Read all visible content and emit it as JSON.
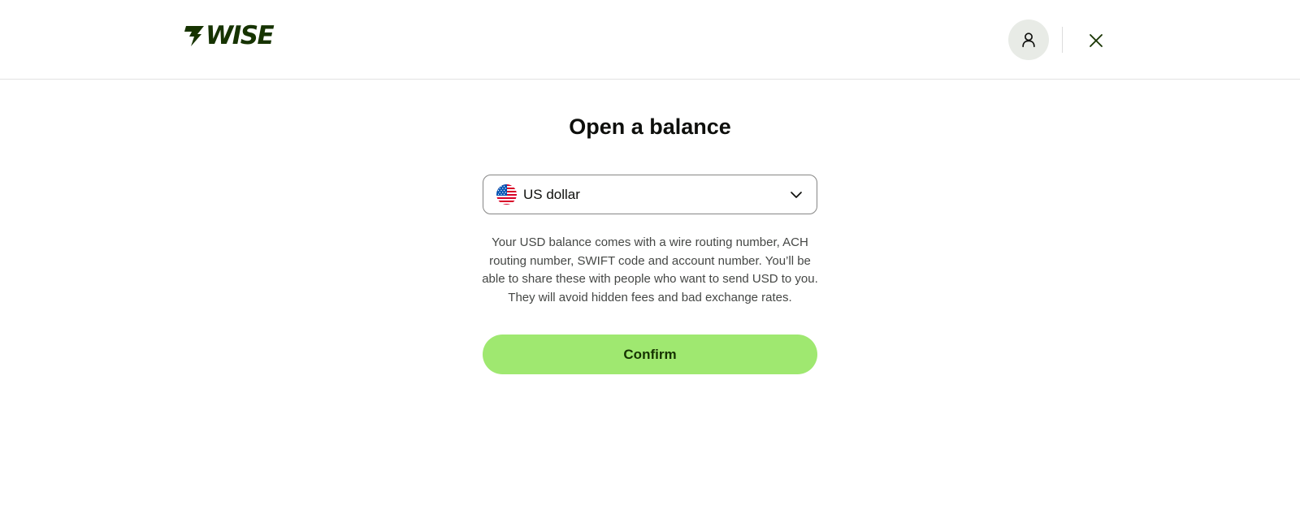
{
  "header": {
    "logo_text": "WISE",
    "avatar_icon": "user-icon",
    "close_icon": "close-icon"
  },
  "main": {
    "title": "Open a balance",
    "currency_select": {
      "flag_icon": "us-flag-icon",
      "selected_value": "US dollar",
      "chevron_icon": "chevron-down-icon"
    },
    "description": "Your USD balance comes with a wire routing number, ACH routing number, SWIFT code and account number. You’ll be able to share these with people who want to send USD to you. They will avoid hidden fees and bad exchange rates.",
    "confirm_label": "Confirm"
  },
  "colors": {
    "brand_dark_green": "#163300",
    "brand_bright_green": "#9fe870",
    "avatar_bg": "#e8ebe6",
    "text_primary": "#0e0f0c",
    "text_secondary": "#454745"
  }
}
